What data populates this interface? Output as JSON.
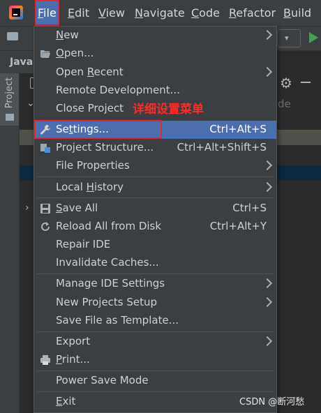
{
  "menubar": {
    "items": [
      {
        "label": "File",
        "mnemonic": "F",
        "rest": "ile"
      },
      {
        "label": "Edit",
        "mnemonic": "E",
        "rest": "dit"
      },
      {
        "label": "View",
        "mnemonic": "V",
        "rest": "iew"
      },
      {
        "label": "Navigate",
        "mnemonic": "N",
        "rest": "avigate"
      },
      {
        "label": "Code",
        "mnemonic": "C",
        "rest": "ode"
      },
      {
        "label": "Refactor",
        "mnemonic": "R",
        "rest": "efactor"
      },
      {
        "label": "Build",
        "mnemonic": "B",
        "rest": "uild"
      }
    ]
  },
  "toolbar": {
    "nav_tab": "Java",
    "dropdown_glyph": "▾"
  },
  "tool_window": {
    "project_label": "Project",
    "editor_hint": "de"
  },
  "file_menu": {
    "items": [
      {
        "label": "New",
        "mn_pre": "",
        "mn": "N",
        "mn_post": "ew",
        "shortcut": "",
        "submenu": true
      },
      {
        "label": "Open...",
        "mn_pre": "",
        "mn": "O",
        "mn_post": "pen...",
        "shortcut": "",
        "submenu": false,
        "icon": "folder-open-icon"
      },
      {
        "label": "Open Recent",
        "mn_pre": "Open ",
        "mn": "R",
        "mn_post": "ecent",
        "shortcut": "",
        "submenu": true
      },
      {
        "label": "Remote Development...",
        "mn_pre": "Remote Development...",
        "mn": "",
        "mn_post": "",
        "shortcut": "",
        "submenu": false
      },
      {
        "label": "Close Project",
        "mn_pre": "Close Pro",
        "mn": "j",
        "mn_post": "ect",
        "shortcut": "",
        "submenu": false
      },
      {
        "label": "Settings...",
        "mn_pre": "Se",
        "mn": "t",
        "mn_post": "tings...",
        "shortcut": "Ctrl+Alt+S",
        "submenu": false,
        "icon": "wrench-icon",
        "selected": true
      },
      {
        "label": "Project Structure...",
        "mn_pre": "Project Structure...",
        "mn": "",
        "mn_post": "",
        "shortcut": "Ctrl+Alt+Shift+S",
        "submenu": false,
        "icon": "project-structure-icon"
      },
      {
        "label": "File Properties",
        "mn_pre": "File Properties",
        "mn": "",
        "mn_post": "",
        "shortcut": "",
        "submenu": true
      },
      {
        "label": "Local History",
        "mn_pre": "Local ",
        "mn": "H",
        "mn_post": "istory",
        "shortcut": "",
        "submenu": true
      },
      {
        "label": "Save All",
        "mn_pre": "",
        "mn": "S",
        "mn_post": "ave All",
        "shortcut": "Ctrl+S",
        "submenu": false,
        "icon": "save-icon"
      },
      {
        "label": "Reload All from Disk",
        "mn_pre": "Reload All from Disk",
        "mn": "",
        "mn_post": "",
        "shortcut": "Ctrl+Alt+Y",
        "submenu": false,
        "icon": "reload-icon"
      },
      {
        "label": "Repair IDE",
        "mn_pre": "Repair IDE",
        "mn": "",
        "mn_post": "",
        "shortcut": "",
        "submenu": false
      },
      {
        "label": "Invalidate Caches...",
        "mn_pre": "Invalidate Caches...",
        "mn": "",
        "mn_post": "",
        "shortcut": "",
        "submenu": false
      },
      {
        "label": "Manage IDE Settings",
        "mn_pre": "Manage IDE Settings",
        "mn": "",
        "mn_post": "",
        "shortcut": "",
        "submenu": true
      },
      {
        "label": "New Projects Setup",
        "mn_pre": "New Projects Setup",
        "mn": "",
        "mn_post": "",
        "shortcut": "",
        "submenu": true
      },
      {
        "label": "Save File as Template...",
        "mn_pre": "Save File as Template...",
        "mn": "",
        "mn_post": "",
        "shortcut": "",
        "submenu": false
      },
      {
        "label": "Export",
        "mn_pre": "Export",
        "mn": "",
        "mn_post": "",
        "shortcut": "",
        "submenu": true
      },
      {
        "label": "Print...",
        "mn_pre": "",
        "mn": "P",
        "mn_post": "rint...",
        "shortcut": "",
        "submenu": false,
        "icon": "print-icon"
      },
      {
        "label": "Power Save Mode",
        "mn_pre": "Power Save Mode",
        "mn": "",
        "mn_post": "",
        "shortcut": "",
        "submenu": false
      },
      {
        "label": "Exit",
        "mn_pre": "",
        "mn": "E",
        "mn_post": "xit",
        "shortcut": "",
        "submenu": false
      }
    ]
  },
  "annotation": {
    "text": "详细设置菜单"
  },
  "watermark": {
    "text": "CSDN @断河愁"
  },
  "colors": {
    "accent": "#4b6eaf",
    "annotation_red": "#e0282e",
    "menu_bg": "#3c3f41"
  }
}
